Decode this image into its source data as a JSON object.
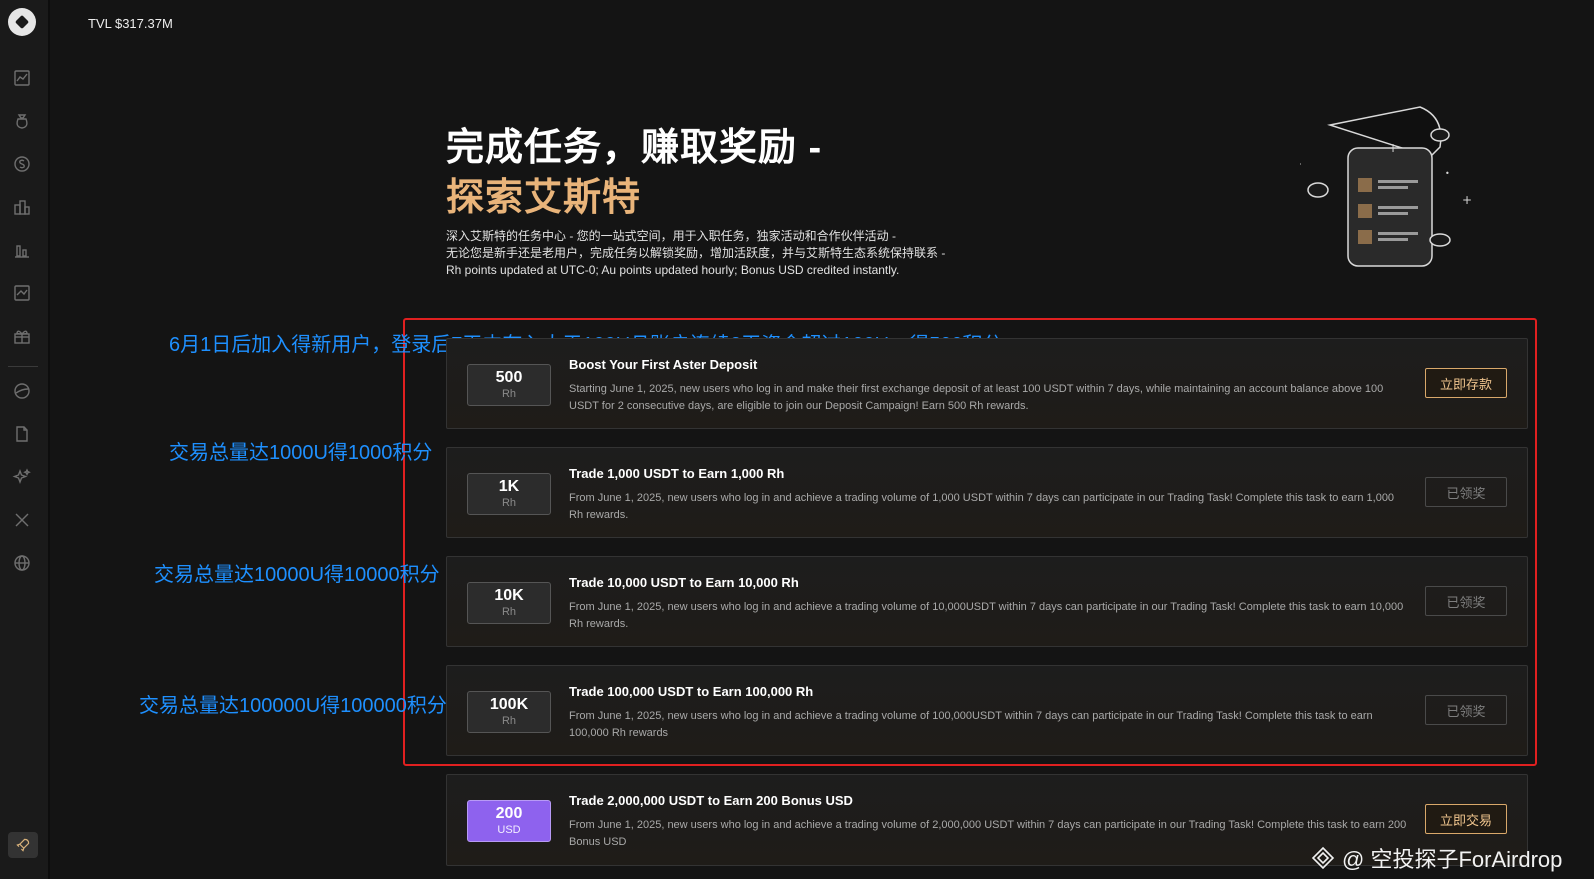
{
  "header": {
    "tvl": "TVL $317.37M"
  },
  "hero": {
    "title_line1": "完成任务，赚取奖励 -",
    "title_line2": "探索艾斯特",
    "desc_line1": "深入艾斯特的任务中心 - 您的一站式空间，用于入职任务，独家活动和合作伙伴活动 -",
    "desc_line2": "无论您是新手还是老用户，完成任务以解锁奖励，增加活跃度，并与艾斯特生态系统保持联系 -",
    "desc_line3": "Rh points updated at UTC-0; Au points updated hourly; Bonus USD credited instantly."
  },
  "annotations": [
    "6月1日后加入得新用户，登录后7天内存入大于100U且账户连续2天资金超过100U，得500积分",
    "交易总量达1000U得1000积分",
    "交易总量达10000U得10000积分",
    "交易总量达100000U得100000积分"
  ],
  "tasks": [
    {
      "badge_value": "500",
      "badge_unit": "Rh",
      "title": "Boost Your First Aster Deposit",
      "desc": "Starting June 1, 2025, new users who log in and make their first exchange deposit of at least 100 USDT within 7 days, while maintaining an account balance above 100 USDT for 2 consecutive days, are eligible to join our Deposit Campaign! Earn 500 Rh rewards.",
      "button": "立即存款",
      "state": "active"
    },
    {
      "badge_value": "1K",
      "badge_unit": "Rh",
      "title": "Trade 1,000 USDT to Earn 1,000 Rh",
      "desc": "From June 1, 2025, new users who log in and achieve a trading volume of 1,000 USDT within 7 days can participate in our Trading Task! Complete this task to earn 1,000 Rh rewards.",
      "button": "已领奖",
      "state": "done"
    },
    {
      "badge_value": "10K",
      "badge_unit": "Rh",
      "title": "Trade 10,000 USDT to Earn 10,000 Rh",
      "desc": "From June 1, 2025, new users who log in and achieve a trading volume of 10,000USDT within 7 days can participate in our Trading Task! Complete this task to earn 10,000 Rh rewards.",
      "button": "已领奖",
      "state": "done"
    },
    {
      "badge_value": "100K",
      "badge_unit": "Rh",
      "title": "Trade 100,000 USDT to Earn 100,000 Rh",
      "desc": "From June 1, 2025, new users who log in and achieve a trading volume of 100,000USDT within 7 days can participate in our Trading Task! Complete this task to earn 100,000 Rh rewards",
      "button": "已领奖",
      "state": "done"
    },
    {
      "badge_value": "200",
      "badge_unit": "USD",
      "title": "Trade 2,000,000 USDT to Earn 200 Bonus USD",
      "desc": "From June 1, 2025, new users who log in and achieve a trading volume of 2,000,000 USDT within 7 days can participate in our Trading Task! Complete this task to earn 200 Bonus USD",
      "button": "立即交易",
      "state": "active"
    }
  ],
  "watermark": "@ 空投探子ForAirdrop",
  "sidebar_icons": [
    "chart-icon",
    "money-bag-icon",
    "dollar-icon",
    "buildings-icon",
    "bar-chart-icon",
    "trend-icon",
    "gift-icon",
    "pie-icon",
    "document-icon",
    "sparkle-icon",
    "x-icon",
    "globe-icon"
  ],
  "colors": {
    "accent_gold": "#e9b47a",
    "annotation_blue": "#1e90ff",
    "highlight_red": "#e02020",
    "usd_badge": "#8e62ee"
  }
}
